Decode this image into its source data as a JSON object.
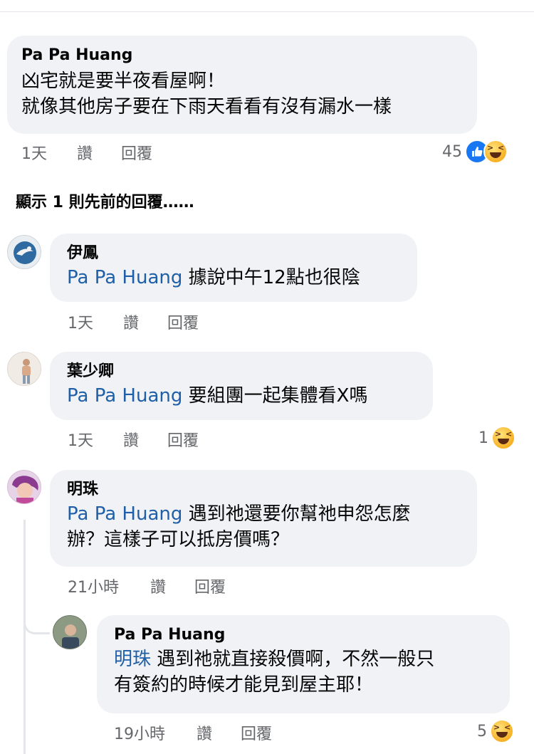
{
  "comment1": {
    "author": "Pa Pa Huang",
    "line1": "凶宅就是要半夜看屋啊！",
    "line2": "就像其他房子要在下雨天看看有沒有漏水一樣",
    "time": "1天",
    "like_label": "讚",
    "reply_label": "回覆",
    "reaction_count": "45"
  },
  "show_previous": "顯示 1 則先前的回覆……",
  "reply1": {
    "author": "伊鳳",
    "mention": "Pa Pa Huang",
    "text": " 據說中午12點也很陰",
    "time": "1天",
    "like_label": "讚",
    "reply_label": "回覆"
  },
  "reply2": {
    "author": "葉少卿",
    "mention": "Pa Pa Huang",
    "text": " 要組團一起集體看X嗎",
    "time": "1天",
    "like_label": "讚",
    "reply_label": "回覆",
    "reaction_count": "1"
  },
  "reply3": {
    "author": "明珠",
    "mention": "Pa Pa Huang",
    "line1": " 遇到祂還要你幫祂申怨怎麼",
    "line2": "辦？這樣子可以抵房價嗎？",
    "time": "21小時",
    "like_label": "讚",
    "reply_label": "回覆"
  },
  "reply4": {
    "author": "Pa Pa Huang",
    "mention": "明珠",
    "line1": " 遇到祂就直接殺價啊，不然一般只",
    "line2": "有簽約的時候才能見到屋主耶！",
    "time": "19小時",
    "like_label": "讚",
    "reply_label": "回覆",
    "reaction_count": "5"
  },
  "colors": {
    "bubble": "#f0f2f5",
    "mention": "#1f5fa8",
    "meta": "#65676b",
    "like_blue": "#1877f2"
  }
}
